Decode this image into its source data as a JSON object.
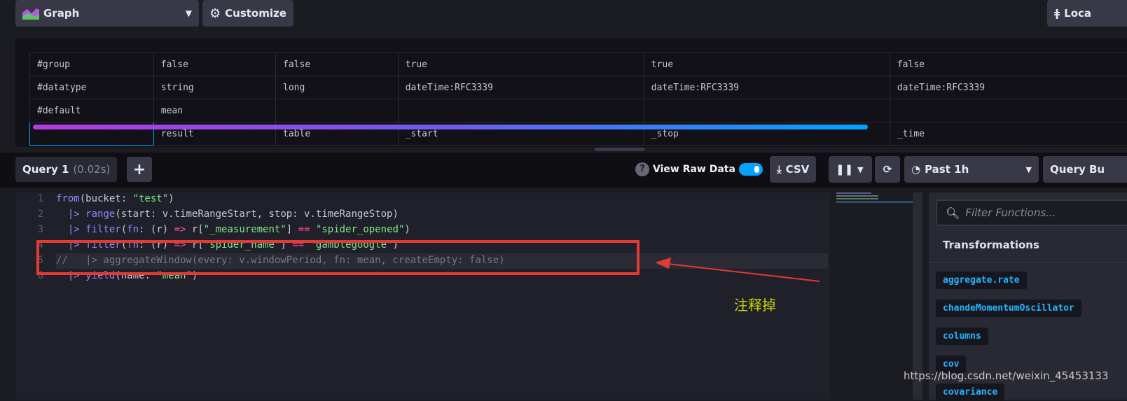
{
  "toolbar": {
    "graph_label": "Graph",
    "customize_label": "Customize",
    "local_label": "Loca"
  },
  "raw_table": {
    "rows": [
      [
        "#group",
        "false",
        "false",
        "true",
        "true",
        "false"
      ],
      [
        "#datatype",
        "string",
        "long",
        "dateTime:RFC3339",
        "dateTime:RFC3339",
        "dateTime:RFC3339"
      ],
      [
        "#default",
        "mean",
        "",
        "",
        "",
        ""
      ],
      [
        "",
        "result",
        "table",
        "_start",
        "_stop",
        "_time"
      ]
    ]
  },
  "query_bar": {
    "tab_label": "Query 1",
    "tab_time": "(0.02s)",
    "add_label": "+",
    "view_raw_label": "View Raw Data",
    "view_raw_on": true,
    "csv_label": "CSV",
    "time_range": "Past 1h",
    "query_builder_label": "Query Bu"
  },
  "editor": {
    "line_numbers": [
      "1",
      "2",
      "3",
      "4",
      "5",
      "6"
    ]
  },
  "functions": {
    "filter_placeholder": "Filter Functions...",
    "section": "Transformations",
    "items": [
      "aggregate.rate",
      "chandeMomentumOscillator",
      "columns",
      "cov",
      "covariance"
    ]
  },
  "annotation": {
    "text": "注释掉",
    "color": "#e53935"
  },
  "watermark": "https://blog.csdn.net/weixin_45453133",
  "colors": {
    "accent": "#00a3ff",
    "annotation_text": "#c8d400"
  }
}
